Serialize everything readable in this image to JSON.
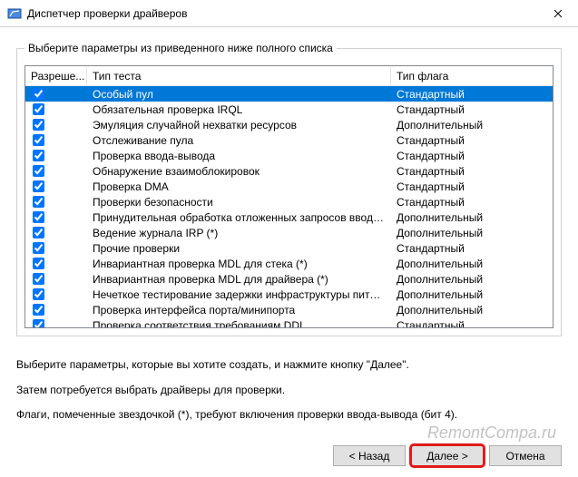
{
  "window": {
    "title": "Диспетчер проверки драйверов"
  },
  "groupbox": {
    "legend": "Выберите параметры из приведенного ниже полного списка"
  },
  "table": {
    "headers": {
      "allow": "Разреше...",
      "test": "Тип теста",
      "flag": "Тип флага"
    },
    "rows": [
      {
        "checked": true,
        "test": "Особый пул",
        "flag": "Стандартный",
        "selected": true
      },
      {
        "checked": true,
        "test": "Обязательная проверка IRQL",
        "flag": "Стандартный"
      },
      {
        "checked": true,
        "test": "Эмуляция случайной нехватки ресурсов",
        "flag": "Дополнительный"
      },
      {
        "checked": true,
        "test": "Отслеживание пула",
        "flag": "Стандартный"
      },
      {
        "checked": true,
        "test": "Проверка ввода-вывода",
        "flag": "Стандартный"
      },
      {
        "checked": true,
        "test": "Обнаружение взаимоблокировок",
        "flag": "Стандартный"
      },
      {
        "checked": true,
        "test": "Проверка DMA",
        "flag": "Стандартный"
      },
      {
        "checked": true,
        "test": "Проверки безопасности",
        "flag": "Стандартный"
      },
      {
        "checked": true,
        "test": "Принудительная обработка отложенных запросов ввода-выво...",
        "flag": "Дополнительный"
      },
      {
        "checked": true,
        "test": "Ведение журнала IRP (*)",
        "flag": "Дополнительный"
      },
      {
        "checked": true,
        "test": "Прочие проверки",
        "flag": "Стандартный"
      },
      {
        "checked": true,
        "test": "Инвариантная проверка MDL для стека (*)",
        "flag": "Дополнительный"
      },
      {
        "checked": true,
        "test": "Инвариантная проверка MDL для драйвера (*)",
        "flag": "Дополнительный"
      },
      {
        "checked": true,
        "test": "Нечеткое тестирование задержки инфраструктуры питания",
        "flag": "Дополнительный"
      },
      {
        "checked": true,
        "test": "Проверка интерфейса порта/минипорта",
        "flag": "Дополнительный"
      },
      {
        "checked": true,
        "test": "Проверка соответствия требованиям DDI",
        "flag": "Стандартный"
      }
    ]
  },
  "hints": {
    "line1": "Выберите параметры, которые вы хотите создать, и нажмите кнопку \"Далее\".",
    "line2": "Затем потребуется выбрать драйверы для проверки.",
    "line3": "Флаги, помеченные звездочкой (*), требуют включения проверки ввода-вывода (бит 4)."
  },
  "buttons": {
    "back": "< Назад",
    "next": "Далее >",
    "cancel": "Отмена"
  },
  "watermark": "RemontCompa.ru"
}
